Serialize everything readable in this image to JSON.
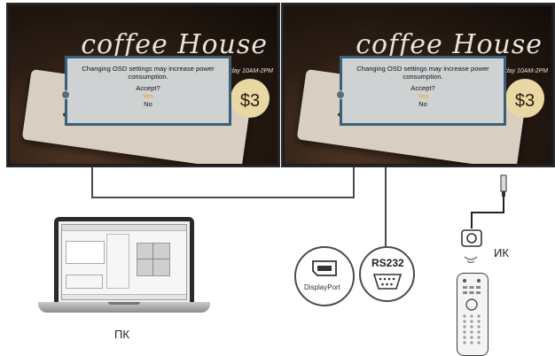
{
  "displays": [
    {
      "brand": "coffee House",
      "hours": "Sunday 10AM-2PM",
      "price": "$3",
      "osd": {
        "message_line1": "Changing OSD settings may increase power",
        "message_line2": "consumption.",
        "question": "Accept?",
        "yes": "Yes",
        "no": "No"
      }
    },
    {
      "brand": "coffee House",
      "hours": "Sunday 10AM-2PM",
      "price": "$3",
      "osd": {
        "message_line1": "Changing OSD settings may increase power",
        "message_line2": "consumption.",
        "question": "Accept?",
        "yes": "Yes",
        "no": "No"
      }
    }
  ],
  "labels": {
    "pc": "ПК",
    "ir": "ИК",
    "displayport": "DisplayPort",
    "rs232": "RS232"
  },
  "colors": {
    "osd_border": "#3a5f78",
    "osd_yes": "#e6a21b",
    "wire": "#4a4a4a"
  }
}
